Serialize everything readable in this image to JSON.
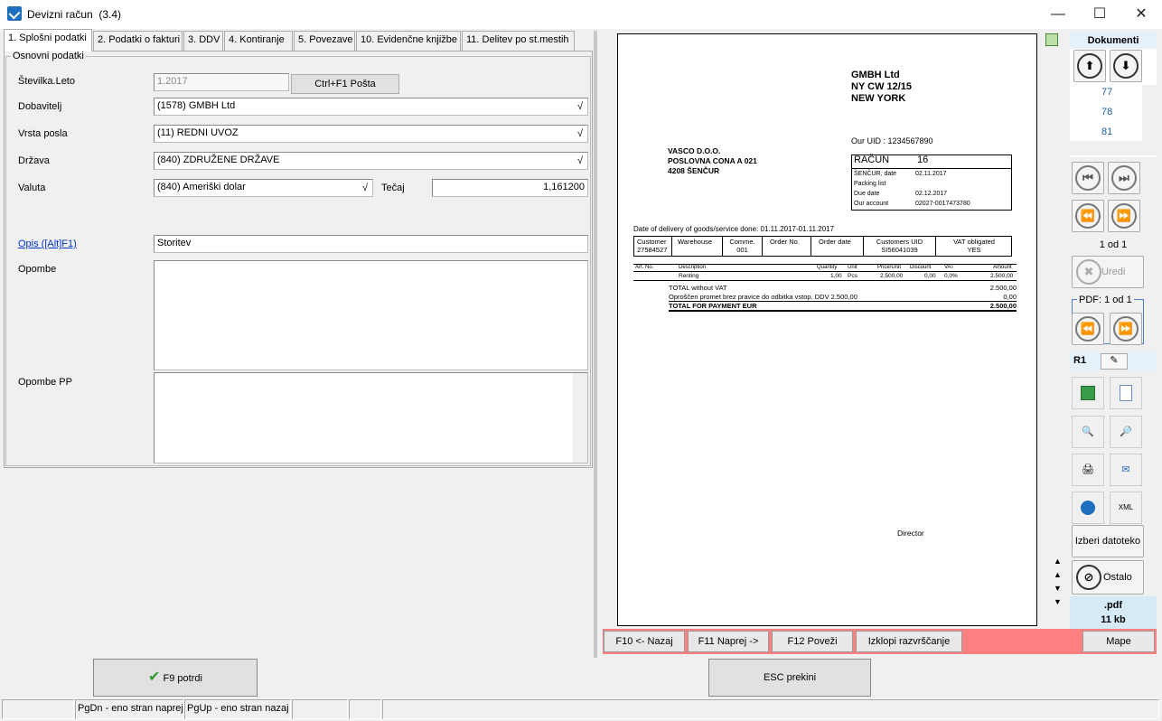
{
  "window": {
    "title": "Devizni račun",
    "version": "(3.4)",
    "min": "—",
    "max": "☐",
    "close": "✕"
  },
  "tabs": [
    "1. Splošni podatki",
    "2. Podatki o fakturi",
    "3. DDV",
    "4. Kontiranje",
    "5. Povezave",
    "10. Evidenčne knjižbe",
    "11. Delitev po st.mestih"
  ],
  "form": {
    "group_label": "Osnovni podatki",
    "stevilka_label": "Številka.Leto",
    "stevilka_value": "1.2017",
    "posta_button": "Ctrl+F1 Pošta",
    "dobavitelj_label": "Dobavitelj",
    "dobavitelj_value": "(1578) GMBH Ltd",
    "vrsta_label": "Vrsta posla",
    "vrsta_value": "(11) REDNI UVOZ",
    "drzava_label": "Država",
    "drzava_value": "(840) ZDRUŽENE DRŽAVE",
    "valuta_label": "Valuta",
    "valuta_value": "(840) Ameriški dolar",
    "tecaj_label": "Tečaj",
    "tecaj_value": "1,161200",
    "opis_label": "Opis ([Alt]F1)",
    "opis_value": "Storitev",
    "opombe_label": "Opombe",
    "opombe_pp_label": "Opombe PP",
    "check": "√"
  },
  "invoice": {
    "seller_name": "GMBH Ltd",
    "seller_addr1": "NY CW 12/15",
    "seller_addr2": "NEW YORK",
    "our_uid": "Our UID : 1234567890",
    "buyer_name": "VASCO D.O.O.",
    "buyer_addr1": "POSLOVNA CONA A 021",
    "buyer_addr2": "4208 ŠENČUR",
    "doc_type": "RAČUN",
    "doc_no": "16",
    "date_label": "ŠENČUR, date",
    "date_value": "02.11.2017",
    "packing": "Packing list",
    "due_label": "Due date",
    "due_value": "02.12.2017",
    "account_label": "Our account",
    "account_value": "02027-0017473780",
    "delivery": "Date of delivery of goods/service done: 01.11.2017-01.11.2017",
    "hdr": [
      [
        "Customer",
        "27584527"
      ],
      [
        "Warehouse",
        ""
      ],
      [
        "Comme.",
        "001"
      ],
      [
        "Order No.",
        ""
      ],
      [
        "Order date",
        ""
      ],
      [
        "Customers UID",
        "SI56041039"
      ],
      [
        "VAT obligated",
        "YES"
      ]
    ],
    "cols": [
      "Art. No.",
      "Description",
      "Quantity",
      "Unit",
      "Price/Unit",
      "Discount",
      "VAT",
      "Amount"
    ],
    "row": [
      "",
      "Renting",
      "1,00",
      "Pcs",
      "2.500,00",
      "0,00",
      "0,0%",
      "2.500,00"
    ],
    "total_wo_label": "TOTAL without VAT",
    "total_wo": "2.500,00",
    "exempt_label": "Oproščen promet brez pravice do odbitka vstop. DDV 2.500,00",
    "exempt": "0,00",
    "total_label": "TOTAL FOR PAYMENT EUR",
    "total": "2.500,00",
    "director": "Director"
  },
  "sidebar": {
    "title": "Dokumenti",
    "items": [
      "77",
      "78",
      "81"
    ],
    "counter": "1 od 1",
    "uredi": "Uredi",
    "pdf_label": "PDF: 1 od 1",
    "r1": "R1",
    "izberi": "Izberi datoteko",
    "ostalo": "Ostalo",
    "ext": ".pdf",
    "size": "11 kb"
  },
  "fkeys": {
    "f10": "F10 <- Nazaj",
    "f11": "F11 Naprej ->",
    "f12": "F12 Poveži",
    "izklopi": "Izklopi razvrščanje",
    "mape": "Mape"
  },
  "actions": {
    "f9": "F9 potrdi",
    "esc": "ESC prekini"
  },
  "status": {
    "pgdn": "PgDn - eno stran naprej",
    "pgup": "PgUp - eno stran nazaj"
  }
}
